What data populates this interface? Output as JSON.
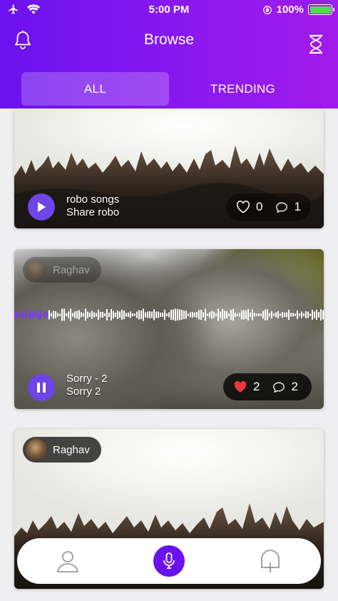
{
  "status_bar": {
    "time": "5:00 PM",
    "battery": "100%"
  },
  "header": {
    "title": "Browse"
  },
  "tabs": [
    {
      "label": "ALL",
      "active": true
    },
    {
      "label": "TRENDING",
      "active": false
    }
  ],
  "feed": {
    "posts": [
      {
        "title": "robo songs",
        "subtitle": "Share robo",
        "likes": "0",
        "comments": "1",
        "liked": false,
        "playing": false
      },
      {
        "user": "Raghav",
        "title": "Sorry - 2",
        "subtitle": "Sorry 2",
        "likes": "2",
        "comments": "2",
        "liked": true,
        "playing": true
      },
      {
        "user": "Raghav"
      }
    ]
  },
  "colors": {
    "accent": "#6a12ee",
    "play_button": "#6e45e6",
    "heart_liked": "#f0363f",
    "waveform_played": "#7a3cf0"
  },
  "icons": {
    "header_left": "bell-icon",
    "header_right": "hourglass-icon",
    "nav": [
      "profile-icon",
      "microphone-icon",
      "add-upload-icon"
    ]
  }
}
